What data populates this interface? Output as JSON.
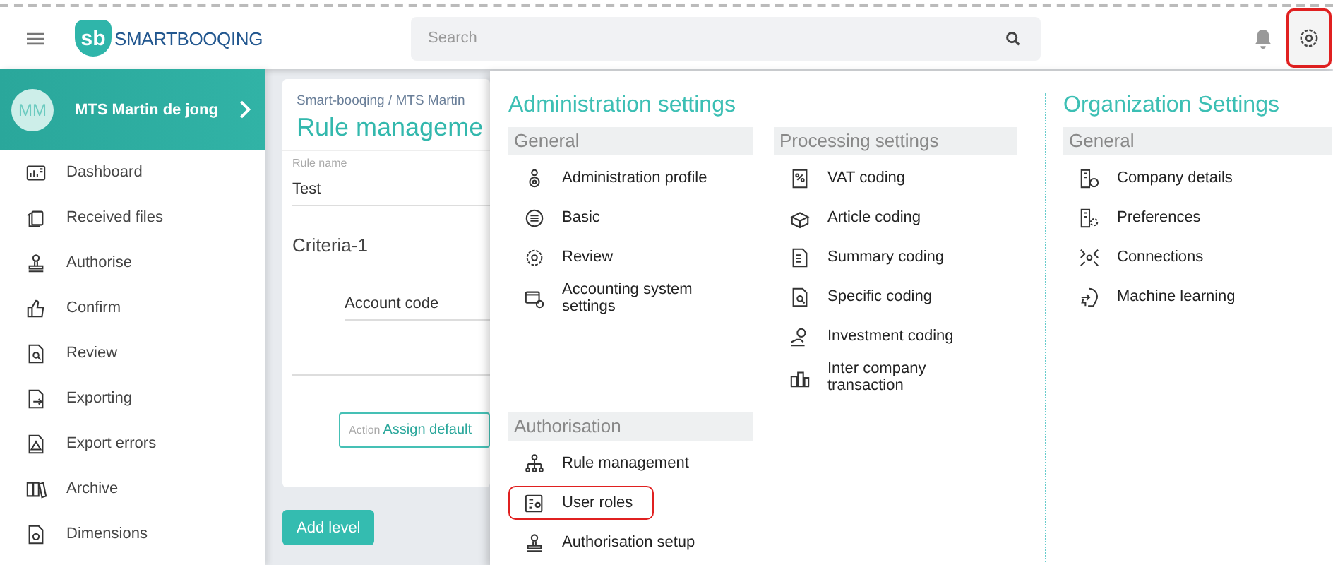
{
  "topbar": {
    "logo": {
      "mark": "sb",
      "name": "SMARTBOOQING"
    },
    "search": {
      "placeholder": "Search"
    },
    "settings_button": {
      "highlighted": true
    }
  },
  "user": {
    "initials": "MM",
    "name": "MTS Martin de jong"
  },
  "sidebar": {
    "items": [
      {
        "label": "Dashboard"
      },
      {
        "label": "Received files"
      },
      {
        "label": "Authorise"
      },
      {
        "label": "Confirm"
      },
      {
        "label": "Review"
      },
      {
        "label": "Exporting"
      },
      {
        "label": "Export errors"
      },
      {
        "label": "Archive"
      },
      {
        "label": "Dimensions"
      }
    ]
  },
  "page": {
    "breadcrumb": "Smart-booqing / MTS Martin",
    "title": "Rule manageme",
    "rule_name": {
      "label": "Rule name",
      "value": "Test"
    },
    "criteria_title": "Criteria-1",
    "account_field": {
      "value": "Account code"
    },
    "action_field": {
      "label": "Action",
      "value": "Assign default"
    },
    "add_level_button": "Add level"
  },
  "settings_menu": {
    "columns": [
      {
        "title": "Administration settings",
        "sections": [
          {
            "heading": "General",
            "items": [
              {
                "label": "Administration profile",
                "highlighted": false
              },
              {
                "label": "Basic",
                "highlighted": false
              },
              {
                "label": "Review",
                "highlighted": false
              },
              {
                "label": "Accounting system settings",
                "highlighted": false
              }
            ]
          },
          {
            "heading": "Processing settings",
            "items": [
              {
                "label": "VAT coding",
                "highlighted": false
              },
              {
                "label": "Article coding",
                "highlighted": false
              },
              {
                "label": "Summary coding",
                "highlighted": false
              },
              {
                "label": "Specific coding",
                "highlighted": false
              },
              {
                "label": "Investment coding",
                "highlighted": false
              },
              {
                "label": "Inter company transaction",
                "highlighted": false
              }
            ]
          },
          {
            "heading": "Authorisation",
            "items": [
              {
                "label": "Rule management",
                "highlighted": false
              },
              {
                "label": "User roles",
                "highlighted": true
              },
              {
                "label": "Authorisation setup",
                "highlighted": false
              }
            ]
          }
        ]
      },
      {
        "title": "Organization Settings",
        "sections": [
          {
            "heading": "General",
            "items": [
              {
                "label": "Company details",
                "highlighted": false
              },
              {
                "label": "Preferences",
                "highlighted": false
              },
              {
                "label": "Connections",
                "highlighted": false
              },
              {
                "label": "Machine learning",
                "highlighted": false
              }
            ]
          }
        ]
      }
    ]
  }
}
